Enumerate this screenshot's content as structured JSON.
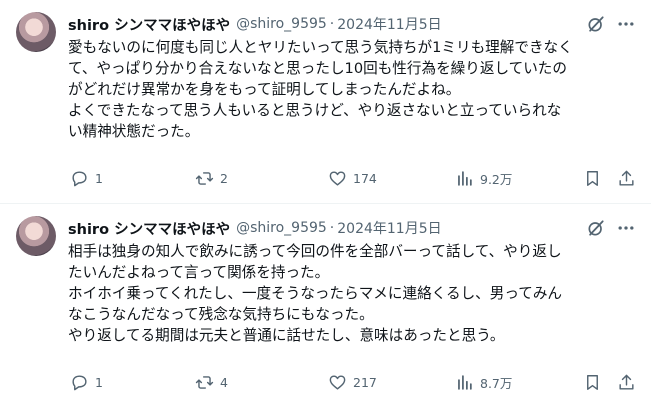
{
  "posts": [
    {
      "author_name": "shiro シンママほやほや",
      "handle": "@shiro_9595",
      "separator": "·",
      "date": "2024年11月5日",
      "lines": [
        "愛もないのに何度も同じ人とヤリたいって思う気持ちが1ミリも理解できなく",
        "て、やっぱり分かり合えないなと思ったし10回も性行為を繰り返していたの",
        "がどれだけ異常かを身をもって証明してしまったんだよね。",
        "よくできたなって思う人もいると思うけど、やり返さないと立っていられな",
        "い精神状態だった。"
      ],
      "replies": "1",
      "reposts": "2",
      "likes": "174",
      "views": "9.2万"
    },
    {
      "author_name": "shiro シンママほやほや",
      "handle": "@shiro_9595",
      "separator": "·",
      "date": "2024年11月5日",
      "lines": [
        "相手は独身の知人で飲みに誘って今回の件を全部バーって話して、やり返し",
        "たいんだよねって言って関係を持った。",
        "ホイホイ乗ってくれたし、一度そうなったらマメに連絡くるし、男ってみん",
        "なこうなんだなって残念な気持ちにもなった。",
        "やり返してる期間は元夫と普通に話せたし、意味はあったと思う。"
      ],
      "replies": "1",
      "reposts": "4",
      "likes": "217",
      "views": "8.7万"
    }
  ]
}
